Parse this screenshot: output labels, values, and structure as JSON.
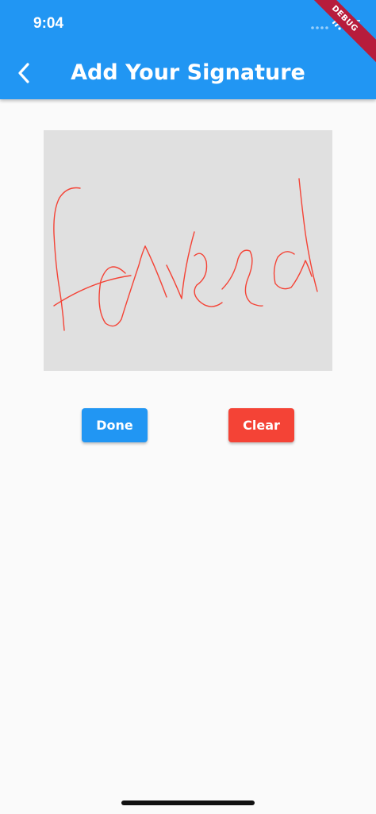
{
  "status_bar": {
    "time": "9:04",
    "icons": [
      "signal-dots-icon",
      "wifi-icon",
      "battery-icon"
    ]
  },
  "app_bar": {
    "title": "Add Your Signature",
    "back_icon": "chevron-left-icon",
    "background": "#2196f3"
  },
  "debug_banner": "DEBUG",
  "signature_pad": {
    "background": "#e0e0e0",
    "stroke_color": "#f44336",
    "signature_text": "Faveed"
  },
  "buttons": {
    "done_label": "Done",
    "done_color": "#2196f3",
    "clear_label": "Clear",
    "clear_color": "#f44336"
  }
}
